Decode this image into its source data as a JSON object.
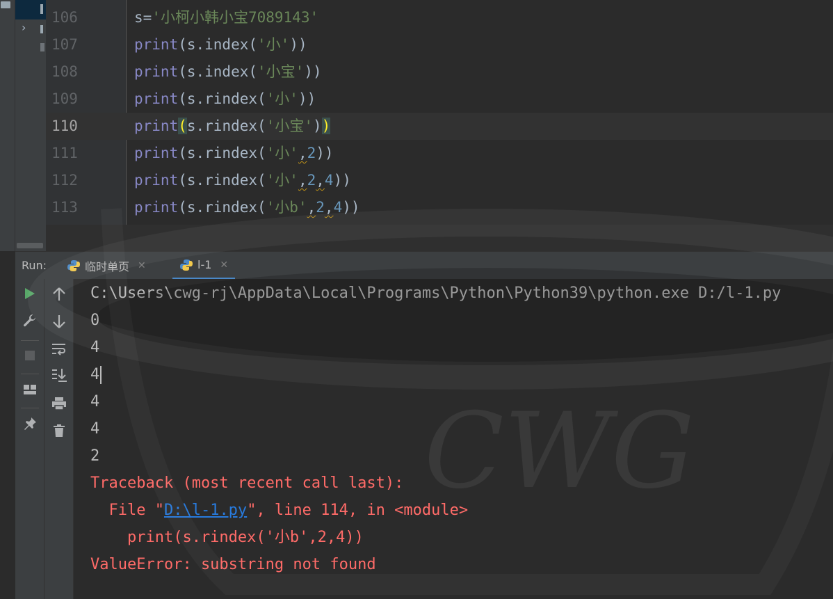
{
  "editor": {
    "lines": [
      {
        "num": "106",
        "segments": [
          [
            "plain",
            "s"
          ],
          [
            "plain",
            "="
          ],
          [
            "str",
            "'小柯小韩小宝7089143'"
          ]
        ]
      },
      {
        "num": "107",
        "segments": [
          [
            "print",
            "print"
          ],
          [
            "plain",
            "(s.index("
          ],
          [
            "str",
            "'小'"
          ],
          [
            "plain",
            "))"
          ]
        ]
      },
      {
        "num": "108",
        "segments": [
          [
            "print",
            "print"
          ],
          [
            "plain",
            "(s.index("
          ],
          [
            "str",
            "'小宝'"
          ],
          [
            "plain",
            "))"
          ]
        ]
      },
      {
        "num": "109",
        "segments": [
          [
            "print",
            "print"
          ],
          [
            "plain",
            "(s.rindex("
          ],
          [
            "str",
            "'小'"
          ],
          [
            "plain",
            "))"
          ]
        ]
      },
      {
        "num": "110",
        "segments": [
          [
            "print",
            "print"
          ],
          [
            "brace",
            "("
          ],
          [
            "plain",
            "s.rindex("
          ],
          [
            "str",
            "'小宝'"
          ],
          [
            "plain",
            ")"
          ],
          [
            "brace",
            ")"
          ]
        ]
      },
      {
        "num": "111",
        "segments": [
          [
            "print",
            "print"
          ],
          [
            "plain",
            "(s.rindex("
          ],
          [
            "str",
            "'小'"
          ],
          [
            "warn",
            ","
          ],
          [
            "num",
            "2"
          ],
          [
            "plain",
            "))"
          ]
        ]
      },
      {
        "num": "112",
        "segments": [
          [
            "print",
            "print"
          ],
          [
            "plain",
            "(s.rindex("
          ],
          [
            "str",
            "'小'"
          ],
          [
            "warn",
            ","
          ],
          [
            "num",
            "2"
          ],
          [
            "warn",
            ","
          ],
          [
            "num",
            "4"
          ],
          [
            "plain",
            "))"
          ]
        ]
      },
      {
        "num": "113",
        "segments": [
          [
            "print",
            "print"
          ],
          [
            "plain",
            "(s.rindex("
          ],
          [
            "str",
            "'小b'"
          ],
          [
            "warn",
            ","
          ],
          [
            "num",
            "2"
          ],
          [
            "warn",
            ","
          ],
          [
            "num",
            "4"
          ],
          [
            "plain",
            "))"
          ]
        ]
      }
    ],
    "current_line": "110"
  },
  "run": {
    "title": "Run:",
    "tabs": [
      {
        "label": "临时单页",
        "active": false
      },
      {
        "label": "l-1",
        "active": true
      }
    ]
  },
  "console": {
    "command": "C:\\Users\\cwg-rj\\AppData\\Local\\Programs\\Python\\Python39\\python.exe D:/l-1.py",
    "outputs": [
      "0",
      "4",
      "4",
      "4",
      "4",
      "2"
    ],
    "traceback_header": "Traceback (most recent call last):",
    "file_prefix": "  File \"",
    "file_link": "D:\\l-1.py",
    "file_suffix": "\", line 114, in <module>",
    "code_line": "    print(s.rindex('小b',2,4))",
    "error": "ValueError: substring not found"
  },
  "icons": {
    "run": "run-icon",
    "wrench": "wrench-icon",
    "stop": "stop-icon",
    "layout": "layout-icon",
    "pin": "pin-icon",
    "up": "arrow-up-icon",
    "down": "arrow-down-icon",
    "wrap": "soft-wrap-icon",
    "scroll": "scroll-to-end-icon",
    "print": "print-icon",
    "trash": "trash-icon"
  },
  "colors": {
    "accent": "#4a88c7",
    "error": "#ff6b68",
    "run_green": "#59a869"
  },
  "watermark": "CWG"
}
